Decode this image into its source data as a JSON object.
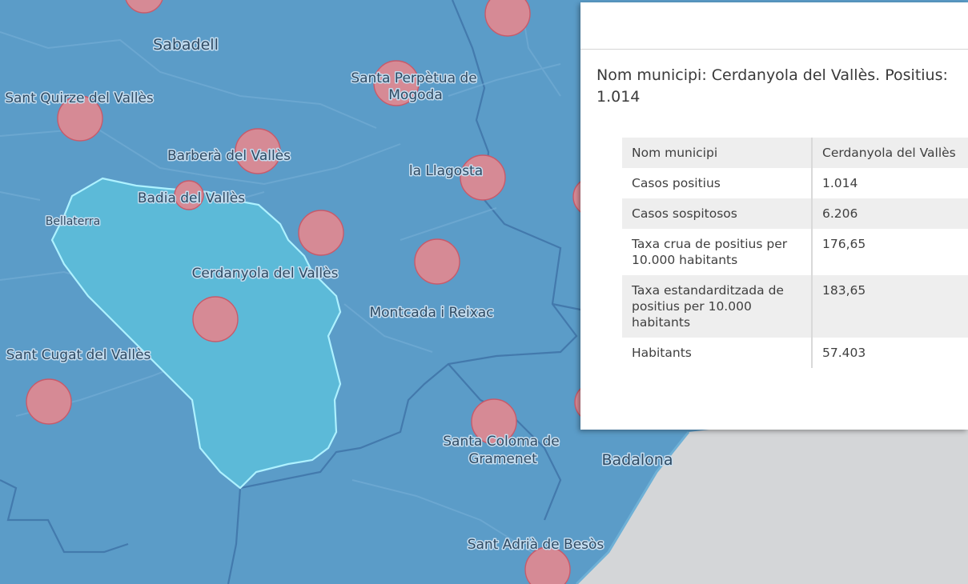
{
  "map": {
    "colors": {
      "base": "#5b9cc8",
      "selected_fill": "#5cbad8",
      "selected_outline": "#aef1ff",
      "case_circle": "#d68a95",
      "sea": "#d4d6d8"
    },
    "labels": {
      "sabadell": "Sabadell",
      "santa_perpetua": [
        "Santa Perpètua de",
        "Mogoda"
      ],
      "sant_quirze": "Sant Quirze del Vallès",
      "barbera": "Barberà del Vallès",
      "la_llagosta": "la Llagosta",
      "badia": "Badia del Vallès",
      "bellaterra": "Bellaterra",
      "cerdanyola": "Cerdanyola del Vallès",
      "montcada": "Montcada i Reixac",
      "sant_cugat": "Sant Cugat del Vallès",
      "santa_coloma": [
        "Santa Coloma de",
        "Gramenet"
      ],
      "badalona": "Badalona",
      "sant_adria": "Sant Adrià de Besòs"
    }
  },
  "popup": {
    "title": "Nom municipi: Cerdanyola del Vallès. Positius: 1.014",
    "rows": [
      {
        "key": "Nom municipi",
        "value": "Cerdanyola del Vallès"
      },
      {
        "key": "Casos positius",
        "value": "1.014"
      },
      {
        "key": "Casos sospitosos",
        "value": "6.206"
      },
      {
        "key": "Taxa crua de positius per 10.000 habitants",
        "value": "176,65"
      },
      {
        "key": "Taxa estandarditzada de positius per 10.000 habitants",
        "value": "183,65"
      },
      {
        "key": "Habitants",
        "value": "57.403"
      }
    ]
  }
}
